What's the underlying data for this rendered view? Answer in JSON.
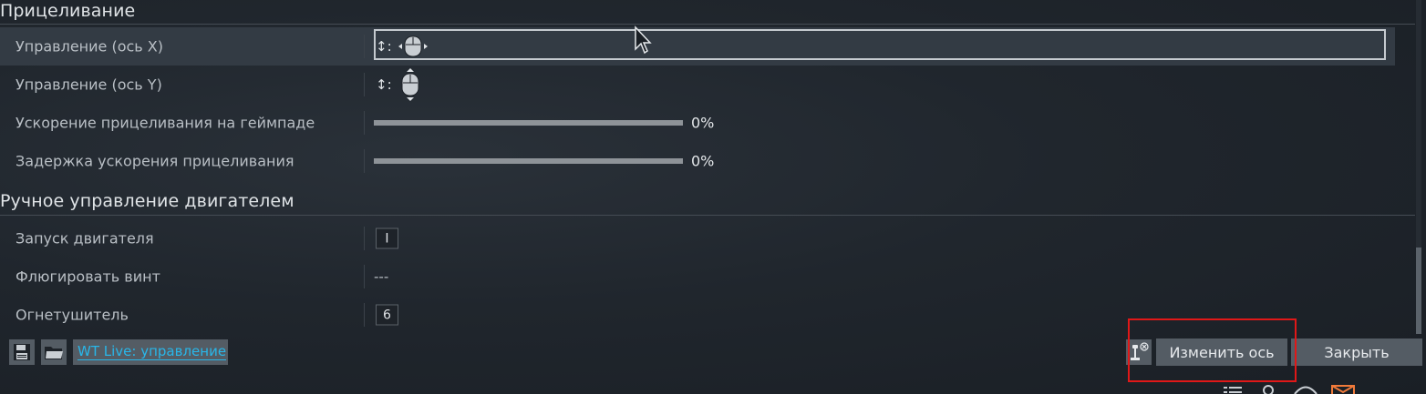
{
  "sections": {
    "aiming": "Прицеливание",
    "engine": "Ручное управление двигателем"
  },
  "rows": {
    "axis_x": {
      "label": "Управление (ось X)",
      "indicator": "↕:"
    },
    "axis_y": {
      "label": "Управление (ось Y)",
      "indicator": "↕:"
    },
    "gamepad_accel": {
      "label": "Ускорение прицеливания на геймпаде",
      "value": "0%",
      "level": 0
    },
    "accel_delay": {
      "label": "Задержка ускорения прицеливания",
      "value": "0%",
      "level": 0
    },
    "engine_start": {
      "label": "Запуск двигателя",
      "key": "I"
    },
    "feather_prop": {
      "label": "Флюгировать винт",
      "key": "---"
    },
    "extinguisher": {
      "label": "Огнетушитель",
      "key": "6"
    }
  },
  "toolbar": {
    "save_icon": "floppy-disk-icon",
    "open_icon": "folder-icon",
    "live_label": "WT Live: управление",
    "clear_icon": "joystick-clear-icon",
    "change_axis_label": "Изменить ось",
    "close_label": "Закрыть"
  },
  "colors": {
    "accent_link": "#29b6e8",
    "highlight": "#e01818",
    "button": "#545c64"
  }
}
